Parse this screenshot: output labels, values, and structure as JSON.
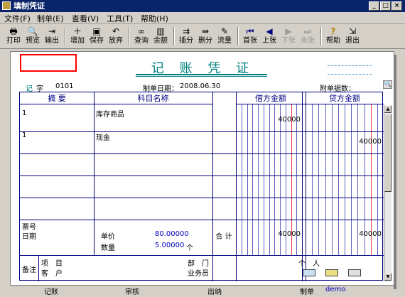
{
  "window": {
    "title": "填制凭证",
    "min": "_",
    "max": "□",
    "close": "×"
  },
  "menu": [
    "文件(F)",
    "制单(E)",
    "查看(V)",
    "工具(T)",
    "帮助(H)"
  ],
  "toolbar": [
    {
      "label": "打印",
      "icon": "printer-icon",
      "glyph": "🖶"
    },
    {
      "label": "预览",
      "icon": "preview-icon",
      "glyph": "🔍"
    },
    {
      "label": "输出",
      "icon": "export-icon",
      "glyph": "⇥"
    },
    {
      "label": "增加",
      "icon": "add-icon",
      "glyph": "＋"
    },
    {
      "label": "保存",
      "icon": "save-icon",
      "glyph": "▣"
    },
    {
      "label": "放弃",
      "icon": "undo-icon",
      "glyph": "↶"
    },
    {
      "label": "查询",
      "icon": "binoculars-icon",
      "glyph": "∞"
    },
    {
      "label": "余额",
      "icon": "balance-icon",
      "glyph": "▥"
    },
    {
      "label": "插分",
      "icon": "insert-row-icon",
      "glyph": "⇉"
    },
    {
      "label": "删分",
      "icon": "delete-row-icon",
      "glyph": "⇛"
    },
    {
      "label": "流量",
      "icon": "flow-icon",
      "glyph": "✎"
    },
    {
      "label": "首张",
      "icon": "first-icon",
      "glyph": "⏮"
    },
    {
      "label": "上张",
      "icon": "prev-icon",
      "glyph": "◀"
    },
    {
      "label": "下张",
      "icon": "next-icon",
      "glyph": "▶"
    },
    {
      "label": "末张",
      "icon": "last-icon",
      "glyph": "⏭"
    },
    {
      "label": "帮助",
      "icon": "help-icon",
      "glyph": "?"
    },
    {
      "label": "退出",
      "icon": "exit-icon",
      "glyph": "⇲"
    }
  ],
  "voucher": {
    "title": "记 账 凭 证",
    "type_label": "记",
    "word_label": "字",
    "number": "0101",
    "date_label": "制单日期：",
    "date": "2008.06.30",
    "attach_label": "附单据数：",
    "headers": {
      "summary": "摘 要",
      "account": "科目名称",
      "debit": "借方金额",
      "credit": "贷方金额"
    },
    "rows": [
      {
        "summary": "1",
        "account": "库存商品",
        "debit": "40000",
        "credit": ""
      },
      {
        "summary": "1",
        "account": "现金",
        "debit": "",
        "credit": "40000"
      },
      {
        "summary": "",
        "account": "",
        "debit": "",
        "credit": ""
      },
      {
        "summary": "",
        "account": "",
        "debit": "",
        "credit": ""
      },
      {
        "summary": "",
        "account": "",
        "debit": "",
        "credit": ""
      }
    ],
    "info": {
      "ticket_label": "票号",
      "date_label": "日期",
      "price_label": "单价",
      "price": "80.00000",
      "qty_label": "数量",
      "qty": "5.00000",
      "unit": "个",
      "total_label": "合 计",
      "total_debit": "40000",
      "total_credit": "40000"
    },
    "remarks": {
      "label": "备注",
      "project_label": "项　目",
      "customer_label": "客　户",
      "dept_label": "部　门",
      "person_label": "个　人",
      "salesman_label": "业务员"
    }
  },
  "footer": {
    "bookkeeping": "记账",
    "audit": "审核",
    "cashier": "出纳",
    "maker_label": "制单",
    "maker": "demo"
  },
  "colors": {
    "accent": "#008080",
    "grid": "#000080",
    "red_box": "#ff0000",
    "titlebar": "#0a246a"
  }
}
